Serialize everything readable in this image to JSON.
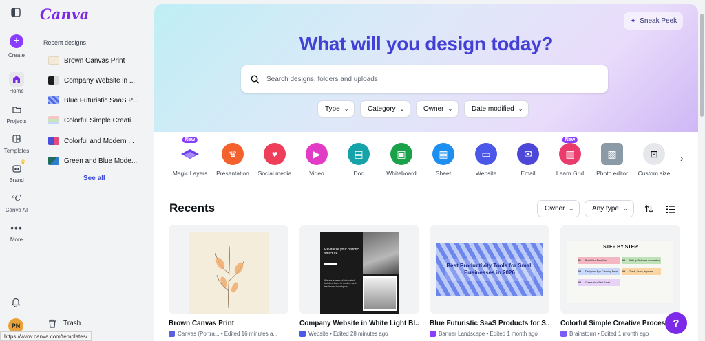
{
  "brand": {
    "logo": "Canva",
    "accent": "#8b3dff"
  },
  "rail": {
    "create": "Create",
    "items": [
      {
        "label": "Home",
        "icon": "home-icon"
      },
      {
        "label": "Projects",
        "icon": "folder-icon"
      },
      {
        "label": "Templates",
        "icon": "templates-icon"
      },
      {
        "label": "Brand",
        "icon": "brand-icon"
      },
      {
        "label": "Canva AI",
        "icon": "canva-ai-icon"
      },
      {
        "label": "More",
        "icon": "more-icon"
      }
    ],
    "avatar": "PN"
  },
  "panel": {
    "title": "Recent designs",
    "items": [
      "Brown Canvas Print",
      "Company Website in ...",
      "Blue Futuristic SaaS P...",
      "Colorful Simple Creati...",
      "Colorful and Modern ...",
      "Green and Blue Mode..."
    ],
    "see_all": "See all",
    "trash": "Trash"
  },
  "hero": {
    "title": "What will you design today?",
    "sneak_peek": "Sneak Peek",
    "search_placeholder": "Search designs, folders and uploads",
    "filters": [
      "Type",
      "Category",
      "Owner",
      "Date modified"
    ]
  },
  "categories": [
    {
      "label": "Magic Layers",
      "badge": "New",
      "color": "#7b4bf0"
    },
    {
      "label": "Presentation",
      "badge": "",
      "color": "#f5612d"
    },
    {
      "label": "Social media",
      "badge": "",
      "color": "#ef3e5a"
    },
    {
      "label": "Video",
      "badge": "",
      "color": "#e23cc7"
    },
    {
      "label": "Doc",
      "badge": "",
      "color": "#14a3a8"
    },
    {
      "label": "Whiteboard",
      "badge": "",
      "color": "#1aa24b"
    },
    {
      "label": "Sheet",
      "badge": "",
      "color": "#1c8ff0"
    },
    {
      "label": "Website",
      "badge": "",
      "color": "#4b57e8"
    },
    {
      "label": "Email",
      "badge": "",
      "color": "#4d47d8"
    },
    {
      "label": "Learn Grid",
      "badge": "New",
      "color": "#ea3b6d"
    },
    {
      "label": "Photo editor",
      "badge": "",
      "color": "#7a8a96"
    },
    {
      "label": "Custom size",
      "badge": "",
      "color": "#e6e7ea"
    }
  ],
  "recents": {
    "title": "Recents",
    "owner": "Owner",
    "any_type": "Any type",
    "cards": [
      {
        "title": "Brown Canvas Print",
        "meta": "Canvas (Portra... • Edited 16 minutes a..."
      },
      {
        "title": "Company Website in White Light Bl...",
        "meta": "Website • Edited 28 minutes ago"
      },
      {
        "title": "Blue Futuristic SaaS Products for S...",
        "meta": "Banner Landscape • Edited 1 month ago"
      },
      {
        "title": "Colorful Simple Creative Process ...",
        "meta": "Brainstorm • Edited 1 month ago"
      }
    ],
    "thumb_texts": {
      "website_headline": "Revitalize your historic structure",
      "website_body": "We are a team of dedicated builders fluent in modern and traditional techniques.",
      "saas_banner": "Best Productivity Tools for Small Businesses in 2026",
      "process_title": "STEP BY STEP",
      "steps": [
        "Build Your Email List",
        "Set Up Welcome Automation",
        "Design an Eye-Catching Email",
        "Track, Learn, Improve",
        "Create Your First Email"
      ],
      "step_numbers": [
        "01",
        "04",
        "02",
        "05",
        "03"
      ]
    }
  },
  "help": "?",
  "status_url": "https://www.canva.com/templates/"
}
